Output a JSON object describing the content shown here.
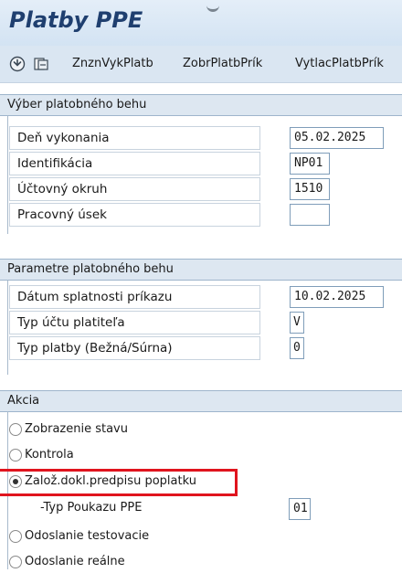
{
  "window": {
    "title": "Platby PPE"
  },
  "toolbar": {
    "execute_icon": "execute-icon",
    "variant_icon": "get-variant-icon",
    "buttons": [
      "ZnznVykPlatb",
      "ZobrPlatbPrík",
      "VytlacPlatbPrík"
    ]
  },
  "section1": {
    "header": "Výber platobného behu",
    "fields": [
      {
        "label": "Deň vykonania",
        "value": "05.02.2025"
      },
      {
        "label": "Identifikácia",
        "value": "NP01"
      },
      {
        "label": "Účtovný okruh",
        "value": "1510"
      },
      {
        "label": "Pracovný úsek",
        "value": ""
      }
    ]
  },
  "section2": {
    "header": "Parametre platobného behu",
    "fields": [
      {
        "label": "Dátum splatnosti príkazu",
        "value": "10.02.2025"
      },
      {
        "label": "Typ účtu platiteľa",
        "value": "V"
      },
      {
        "label": "Typ platby (Bežná/Súrna)",
        "value": "0"
      }
    ]
  },
  "section3": {
    "header": "Akcia",
    "options": [
      {
        "label": "Zobrazenie stavu",
        "selected": false
      },
      {
        "label": "Kontrola",
        "selected": false
      },
      {
        "label": "Založ.dokl.predpisu poplatku",
        "selected": true
      },
      {
        "label": "Odoslanie testovacie",
        "selected": false
      },
      {
        "label": "Odoslanie reálne",
        "selected": false
      }
    ],
    "sub_field": {
      "label": "-Typ Poukazu PPE",
      "value": "01"
    }
  },
  "colors": {
    "highlight": "#e0141e",
    "accent": "#1f3f6f"
  }
}
